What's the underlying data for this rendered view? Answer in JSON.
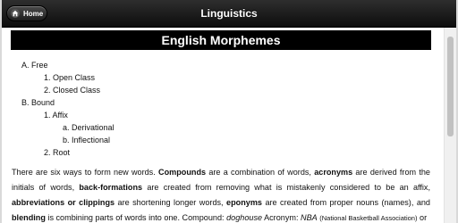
{
  "header": {
    "title": "Linguistics",
    "home_label": "Home"
  },
  "page": {
    "title": "English Morphemes"
  },
  "outline": {
    "a": "A. Free",
    "a1": "1. Open Class",
    "a2": "2. Closed Class",
    "b": "B. Bound",
    "b1": "1. Affix",
    "b1a": "a. Derivational",
    "b1b": "b. Inflectional",
    "b2": "2. Root"
  },
  "paragraph": {
    "t1": "There are six ways to form new words. ",
    "compounds": "Compounds",
    "t2": " are a combination of words, ",
    "acronyms": "acronyms",
    "t3": " are derived from the initials of words, ",
    "backformations": "back-formations",
    "t4": " are created from removing what is mistakenly considered to be an affix, ",
    "abbreviations": "abbreviations or clippings",
    "t5": " are shortening longer words, ",
    "eponyms": "eponyms",
    "t6": " are created from proper nouns (names), and ",
    "blending": "blending",
    "t7": " is combining parts of words into one. Compound: ",
    "ex_compound": "doghouse",
    "t8": " Acronym: ",
    "ex_acronym": "NBA",
    "ex_acronym_note": "(National Basketball Association)",
    "t9": " or"
  }
}
